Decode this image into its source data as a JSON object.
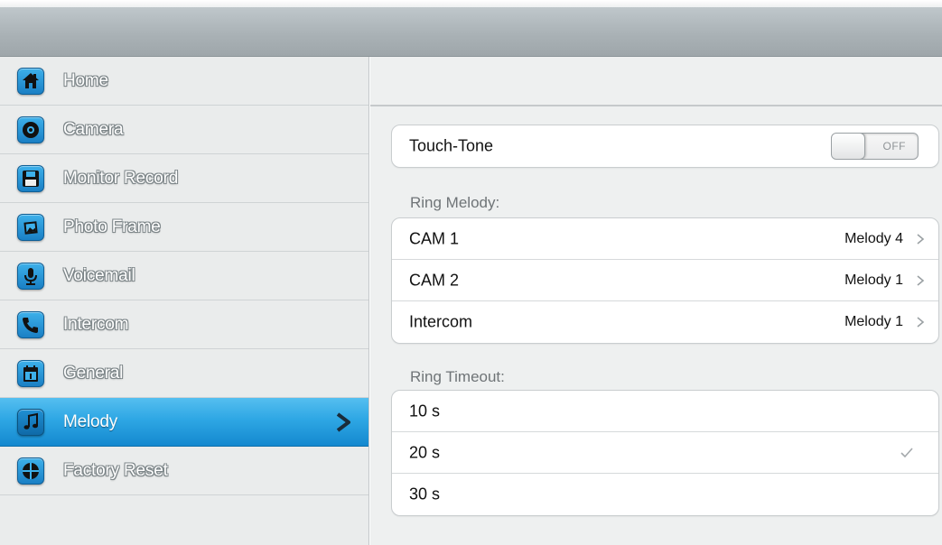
{
  "sidebar": {
    "items": [
      {
        "label": "Home",
        "icon": "home-icon"
      },
      {
        "label": "Camera",
        "icon": "camera-icon"
      },
      {
        "label": "Monitor Record",
        "icon": "floppy-icon"
      },
      {
        "label": "Photo Frame",
        "icon": "photo-frame-icon"
      },
      {
        "label": "Voicemail",
        "icon": "microphone-icon"
      },
      {
        "label": "Intercom",
        "icon": "phone-icon"
      },
      {
        "label": "General",
        "icon": "calendar-icon"
      },
      {
        "label": "Melody",
        "icon": "music-note-icon",
        "active": true
      },
      {
        "label": "Factory Reset",
        "icon": "reset-icon"
      }
    ],
    "accent": "#2ea7e4"
  },
  "touch_tone": {
    "label": "Touch-Tone",
    "state": "OFF"
  },
  "ring_melody": {
    "title": "Ring Melody:",
    "rows": [
      {
        "label": "CAM 1",
        "value": "Melody 4"
      },
      {
        "label": "CAM 2",
        "value": "Melody 1"
      },
      {
        "label": "Intercom",
        "value": "Melody 1"
      }
    ]
  },
  "ring_timeout": {
    "title": "Ring Timeout:",
    "options": [
      {
        "label": "10 s",
        "selected": false
      },
      {
        "label": "20 s",
        "selected": true
      },
      {
        "label": "30 s",
        "selected": false
      }
    ]
  }
}
